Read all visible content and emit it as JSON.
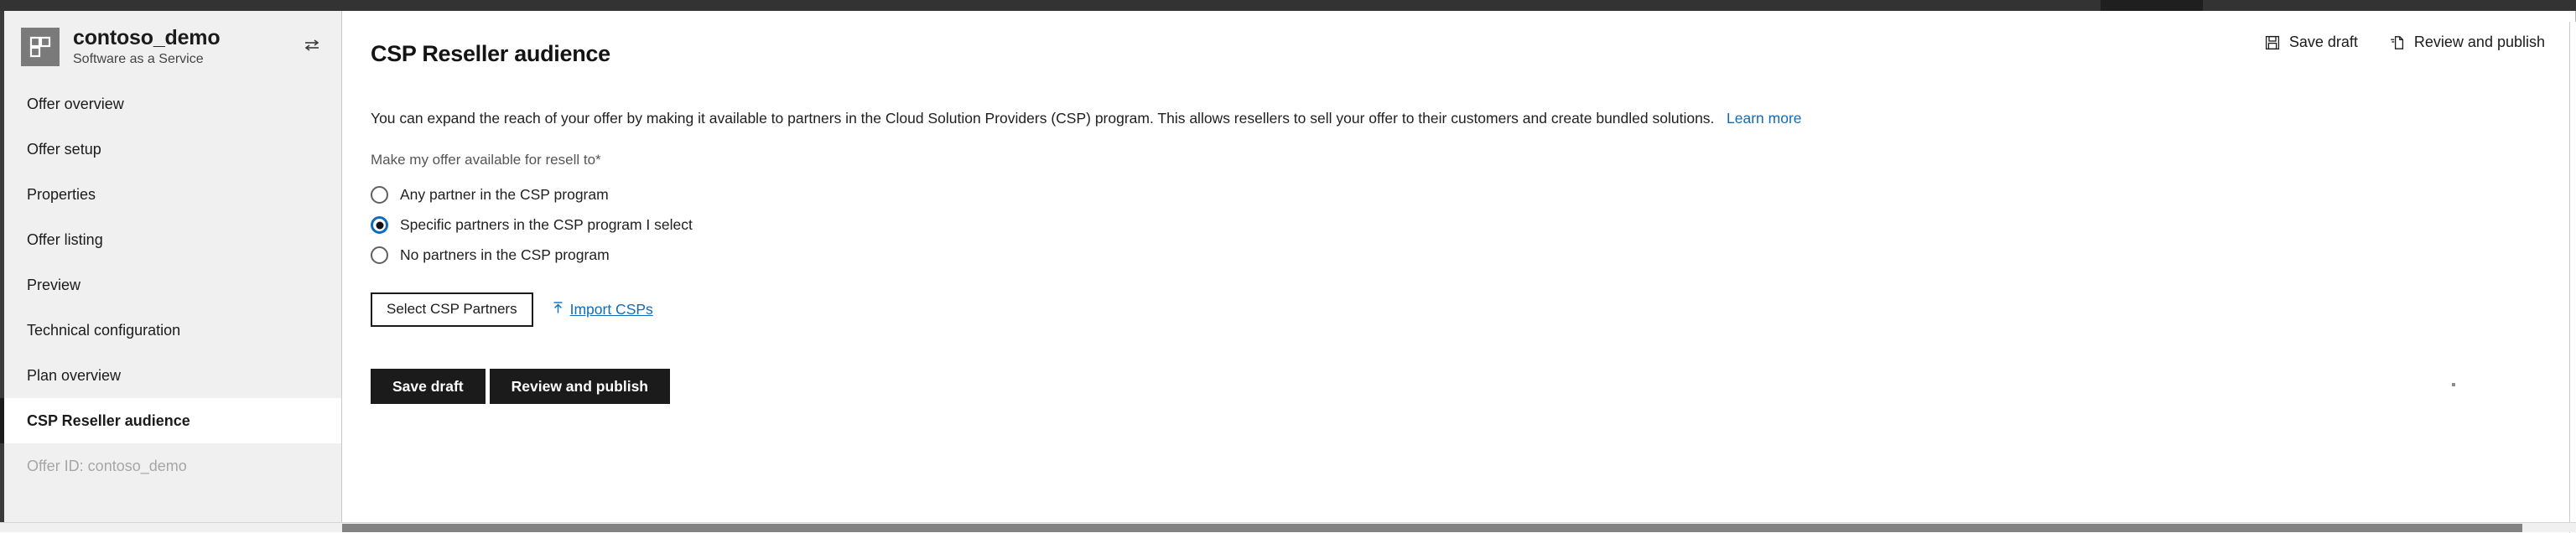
{
  "window": {
    "topbar_color": "#2b2b2b"
  },
  "sidebar": {
    "offer": {
      "name": "contoso_demo",
      "subtitle": "Software as a Service",
      "logo_icon": "grid-blocks-icon",
      "swap_icon": "swap-arrows-icon"
    },
    "items": [
      {
        "label": "Offer overview",
        "selected": false
      },
      {
        "label": "Offer setup",
        "selected": false
      },
      {
        "label": "Properties",
        "selected": false
      },
      {
        "label": "Offer listing",
        "selected": false
      },
      {
        "label": "Preview",
        "selected": false
      },
      {
        "label": "Technical configuration",
        "selected": false
      },
      {
        "label": "Plan overview",
        "selected": false
      },
      {
        "label": "CSP Reseller audience",
        "selected": true
      }
    ],
    "offer_id": "Offer ID: contoso_demo"
  },
  "header": {
    "title": "CSP Reseller audience",
    "actions": [
      {
        "label": "Save draft",
        "icon": "save-floppy-icon"
      },
      {
        "label": "Review and publish",
        "icon": "publish-document-icon"
      }
    ]
  },
  "main": {
    "description": "You can expand the reach of your offer by making it available to partners in the Cloud Solution Providers (CSP) program. This allows resellers to sell your offer to their customers and create bundled solutions.",
    "learn_more": "Learn more",
    "field_label": "Make my offer available for resell to",
    "required_marker": "*",
    "options": [
      {
        "label": "Any partner in the CSP program",
        "checked": false
      },
      {
        "label": "Specific partners in the CSP program I select",
        "checked": true
      },
      {
        "label": "No partners in the CSP program",
        "checked": false
      }
    ],
    "select_partners_button": "Select CSP Partners",
    "import_link": "Import CSPs",
    "import_icon": "upload-arrow-icon",
    "footer_buttons": [
      {
        "label": "Save draft"
      },
      {
        "label": "Review and publish"
      }
    ]
  },
  "colors": {
    "link": "#0f6cbd",
    "accent_radio": "#0f6cbd",
    "primary_button_bg": "#1b1b1b",
    "sidebar_bg": "#f0f0f0"
  }
}
